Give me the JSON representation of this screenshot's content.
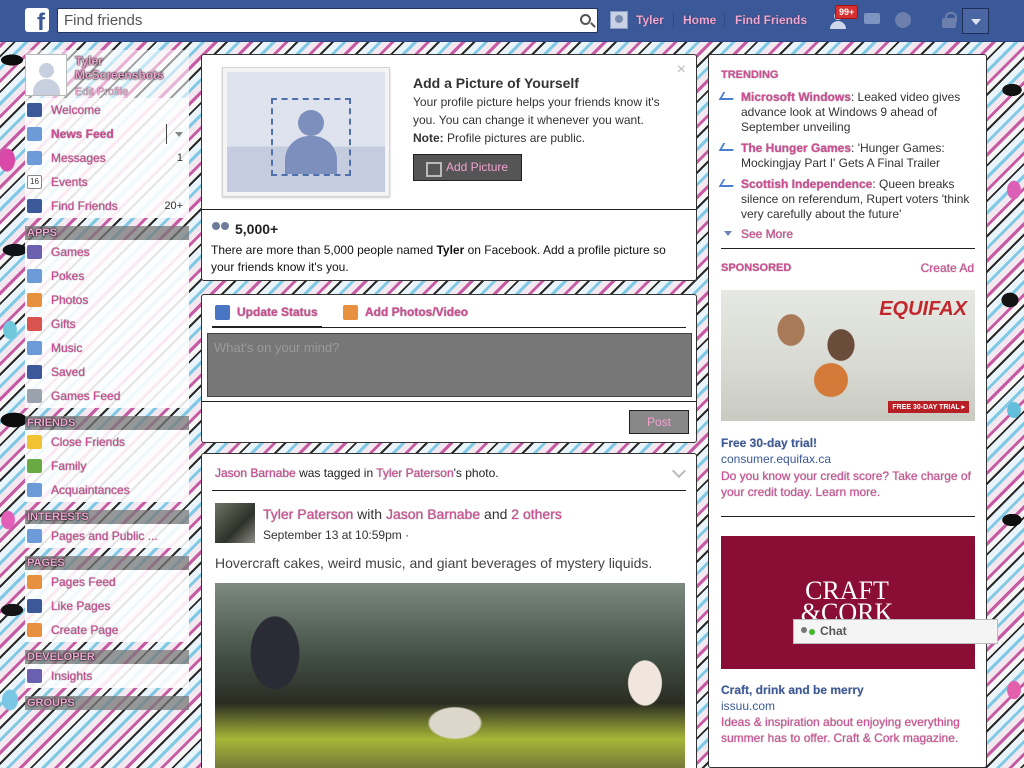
{
  "topbar": {
    "logo": "f",
    "search_placeholder": "Find friends",
    "user_name": "Tyler",
    "home_label": "Home",
    "find_friends_label": "Find Friends",
    "requests_badge": "99+"
  },
  "leftnav": {
    "profile_name": "Tyler McScreenshots",
    "edit_profile": "Edit Profile",
    "main_items": [
      {
        "label": "Welcome",
        "count": ""
      },
      {
        "label": "News Feed",
        "count": ""
      },
      {
        "label": "Messages",
        "count": "1"
      },
      {
        "label": "Events",
        "count": ""
      },
      {
        "label": "Find Friends",
        "count": "20+"
      }
    ],
    "events_icon_text": "16",
    "apps_heading": "APPS",
    "apps": [
      "Games",
      "Pokes",
      "Photos",
      "Gifts",
      "Music",
      "Saved",
      "Games Feed"
    ],
    "friends_heading": "FRIENDS",
    "friends": [
      "Close Friends",
      "Family",
      "Acquaintances"
    ],
    "interests_heading": "INTERESTS",
    "interests": [
      "Pages and Public ..."
    ],
    "pages_heading": "PAGES",
    "pages": [
      "Pages Feed",
      "Like Pages",
      "Create Page"
    ],
    "developer_heading": "DEVELOPER",
    "developer": [
      "Insights"
    ],
    "groups_heading": "GROUPS"
  },
  "profile_prompt": {
    "title": "Add a Picture of Yourself",
    "description": "Your profile picture helps your friends know it's you. You can change it whenever you want.",
    "note_label": "Note:",
    "note_text": " Profile pictures are public.",
    "button_label": "Add Picture",
    "close": "×",
    "count": "5,000+",
    "people_text_1": "There are more than 5,000 people named ",
    "people_name": "Tyler",
    "people_text_2": " on Facebook. Add a profile picture so your friends know it's you."
  },
  "composer": {
    "update_status": "Update Status",
    "add_photos": "Add Photos/Video",
    "placeholder": "What's on your mind?",
    "post_label": "Post"
  },
  "story": {
    "tagged_name": "Jason Barnabe",
    "tagged_text": " was tagged in ",
    "owner": "Tyler Paterson",
    "owner_suffix": "'s photo.",
    "author": "Tyler Paterson",
    "with_text": " with ",
    "with_name": "Jason Barnabe",
    "and_text": " and ",
    "others": "2 others",
    "timestamp": "September 13 at 10:59pm · ",
    "body": "Hovercraft cakes, weird music, and giant beverages of mystery liquids."
  },
  "rightcol": {
    "trending_heading": "TRENDING",
    "trends": [
      {
        "topic": "Microsoft Windows",
        "text": ": Leaked video gives advance look at Windows 9 ahead of September unveiling"
      },
      {
        "topic": "The Hunger Games",
        "text": ": 'Hunger Games: Mockingjay Part I' Gets A Final Trailer"
      },
      {
        "topic": "Scottish Independence",
        "text": ": Queen breaks silence on referendum, Rupert voters 'think very carefully about the future'"
      }
    ],
    "see_more": "See More",
    "sponsored_heading": "SPONSORED",
    "create_ad": "Create Ad",
    "ads": [
      {
        "brand": "EQUIFAX",
        "badge": "FREE 30-DAY TRIAL ▸",
        "title": "Free 30-day trial!",
        "url": "consumer.equifax.ca",
        "body": "Do you know your credit score? Take charge of your credit today. Learn more."
      },
      {
        "brand": "CRAFT\n&CORK",
        "title": "Craft, drink and be merry",
        "url": "issuu.com",
        "body": "Ideas & inspiration about enjoying everything summer has to offer. Craft & Cork magazine."
      }
    ]
  },
  "chat": {
    "label": "Chat"
  }
}
